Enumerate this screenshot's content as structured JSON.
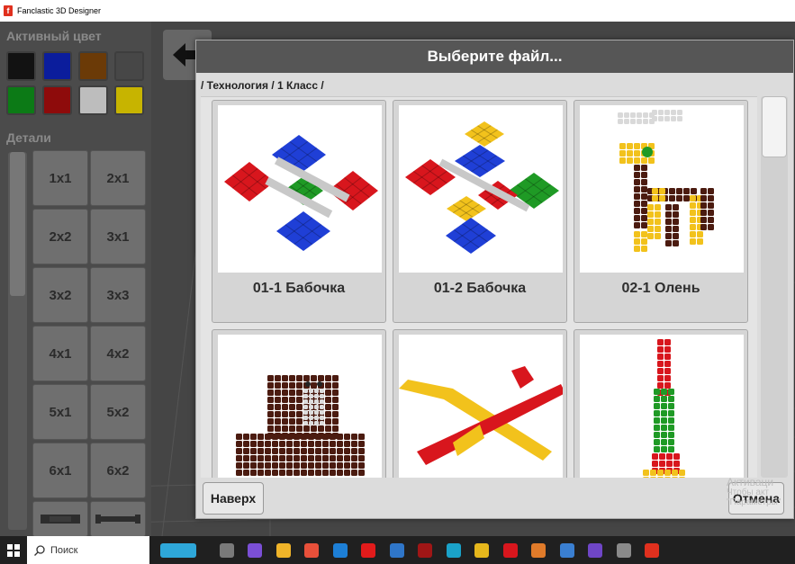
{
  "window": {
    "title": "Fanclastic 3D Designer",
    "logo_letter": "f"
  },
  "left_panel": {
    "active_color_title": "Активный цвет",
    "colors": [
      "#121212",
      "#0b1d9c",
      "#6b3a07",
      "#474747",
      "#0c7a16",
      "#8e0b0b",
      "#bdbdbd",
      "#c7b400"
    ],
    "parts_title": "Детали",
    "parts": [
      "1x1",
      "2x1",
      "2x2",
      "3x1",
      "3x2",
      "3x3",
      "4x1",
      "4x2",
      "5x1",
      "5x2",
      "6x1",
      "6x2"
    ]
  },
  "dialog": {
    "title": "Выберите файл...",
    "breadcrumb": "/ Технология / 1 Класс /",
    "files": [
      {
        "label": "01-1 Бабочка",
        "model": "butterfly-1"
      },
      {
        "label": "01-2 Бабочка",
        "model": "butterfly-2"
      },
      {
        "label": "02-1 Олень",
        "model": "deer"
      },
      {
        "label": "",
        "model": "walrus"
      },
      {
        "label": "",
        "model": "airplane"
      },
      {
        "label": "",
        "model": "rocket"
      }
    ],
    "up_button": "Наверх",
    "cancel_button": "Отмена"
  },
  "watermark": {
    "line1": "Активаци",
    "line2": "Чтобы акт",
    "line3": "\"Параметры\""
  },
  "taskbar": {
    "search_placeholder": "Поиск",
    "icons": [
      "town-app-icon",
      "task-view-icon",
      "app-purple-icon",
      "store-icon",
      "chrome-icon",
      "mail-icon",
      "yandex-icon",
      "photos-icon",
      "app-red-icon",
      "edge-icon",
      "explorer-icon",
      "yandex-browser-icon",
      "app-orange-icon",
      "gallery-icon",
      "app-people-icon",
      "app-bird-icon",
      "fanclastic-icon"
    ]
  }
}
